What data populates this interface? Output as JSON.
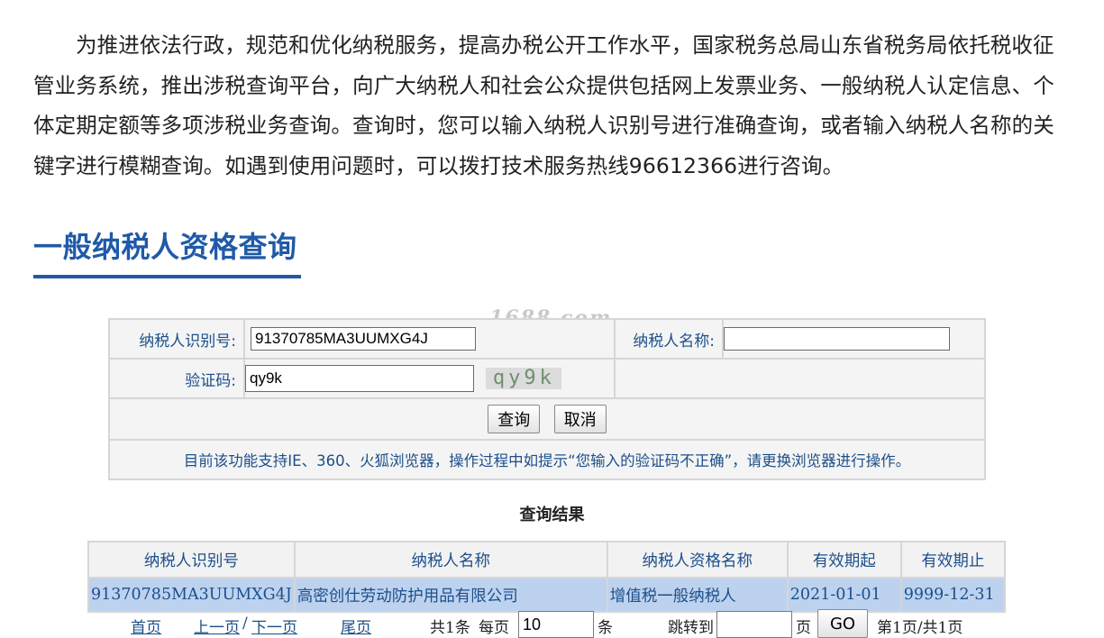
{
  "intro": {
    "text": "为推进依法行政，规范和优化纳税服务，提高办税公开工作水平，国家税务总局山东省税务局依托税收征管业务系统，推出涉税查询平台，向广大纳税人和社会公众提供包括网上发票业务、一般纳税人认定信息、个体定期定额等多项涉税业务查询。查询时，您可以输入纳税人识别号进行准确查询，或者输入纳税人名称的关键字进行模糊查询。如遇到使用问题时，可以拨打技术服务热线96612366进行咨询。"
  },
  "section_title": "一般纳税人资格查询",
  "watermark": "1688.com",
  "form": {
    "taxpayer_id_label": "纳税人识别号:",
    "taxpayer_id_value": "91370785MA3UUMXG4J",
    "taxpayer_name_label": "纳税人名称:",
    "taxpayer_name_value": "",
    "captcha_label": "验证码:",
    "captcha_value": "qy9k",
    "captcha_image_text": "qy9k",
    "query_button": "查询",
    "cancel_button": "取消",
    "browser_notice": "目前该功能支持IE、360、火狐浏览器，操作过程中如提示“您输入的验证码不正确”，请更换浏览器进行操作。"
  },
  "results": {
    "title": "查询结果",
    "columns": [
      "纳税人识别号",
      "纳税人名称",
      "纳税人资格名称",
      "有效期起",
      "有效期止"
    ],
    "rows": [
      [
        "91370785MA3UUMXG4J",
        "高密创仕劳动防护用品有限公司",
        "增值税一般纳税人",
        "2021-01-01",
        "9999-12-31"
      ]
    ]
  },
  "pager": {
    "first": "首页",
    "prev": "上一页",
    "slash": "/",
    "next": "下一页",
    "last": "尾页",
    "total": "共1条",
    "per_page_label": "每页",
    "per_page_value": "10",
    "per_page_unit": "条",
    "jump_label": "跳转到",
    "jump_value": "",
    "page_unit": "页",
    "go_button": "GO",
    "page_status": "第1页/共1页"
  }
}
